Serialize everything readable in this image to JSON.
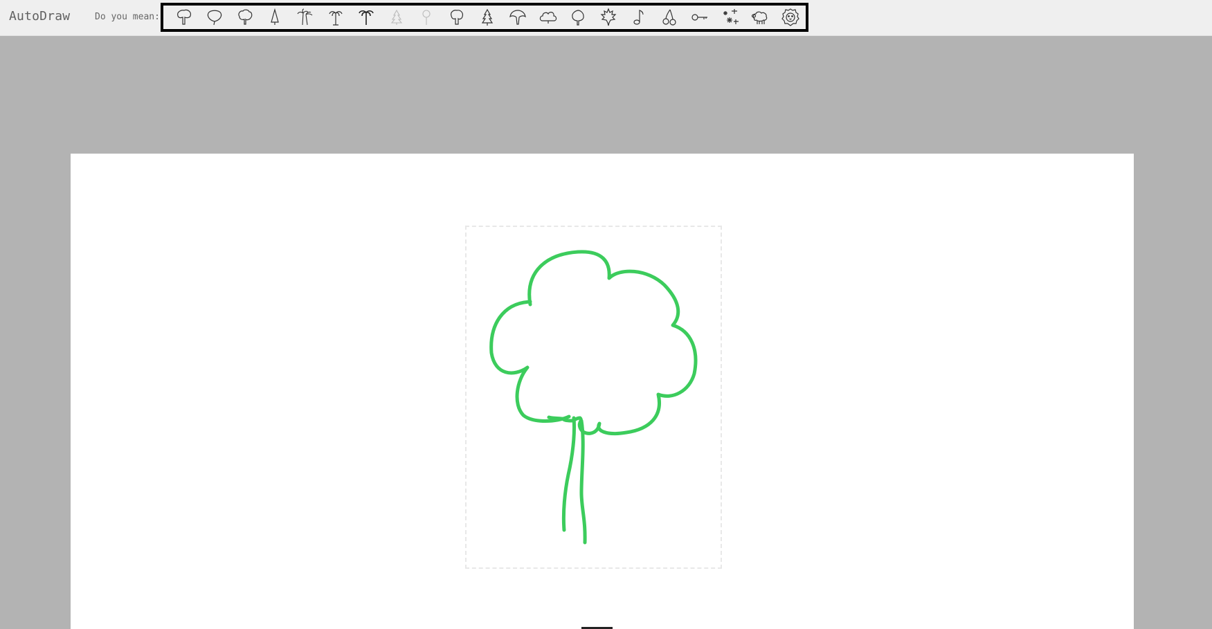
{
  "app": {
    "title": "AutoDraw"
  },
  "toolbar": {
    "prompt_label": "Do you mean:",
    "suggestions": [
      {
        "name": "tree-mushroom-icon"
      },
      {
        "name": "tree-balloon-icon"
      },
      {
        "name": "tree-bushy-icon"
      },
      {
        "name": "tree-cone-icon"
      },
      {
        "name": "palm-trees-icon"
      },
      {
        "name": "palm-tree-icon"
      },
      {
        "name": "palm-tree-dark-icon"
      },
      {
        "name": "pine-tree-faint-icon"
      },
      {
        "name": "lollipop-tree-faint-icon"
      },
      {
        "name": "tree-round-icon"
      },
      {
        "name": "pine-tree-icon"
      },
      {
        "name": "tree-umbrella-icon"
      },
      {
        "name": "cloud-icon"
      },
      {
        "name": "tree-leafy-icon"
      },
      {
        "name": "maple-leaf-icon"
      },
      {
        "name": "music-note-icon"
      },
      {
        "name": "cherries-icon"
      },
      {
        "name": "key-icon"
      },
      {
        "name": "snowflakes-icon"
      },
      {
        "name": "sheep-icon"
      },
      {
        "name": "lion-face-icon"
      }
    ]
  },
  "colors": {
    "stroke": "#3ccc5c",
    "topbar_bg": "#efefef",
    "stage_bg": "#b3b3b3",
    "canvas_bg": "#ffffff"
  }
}
